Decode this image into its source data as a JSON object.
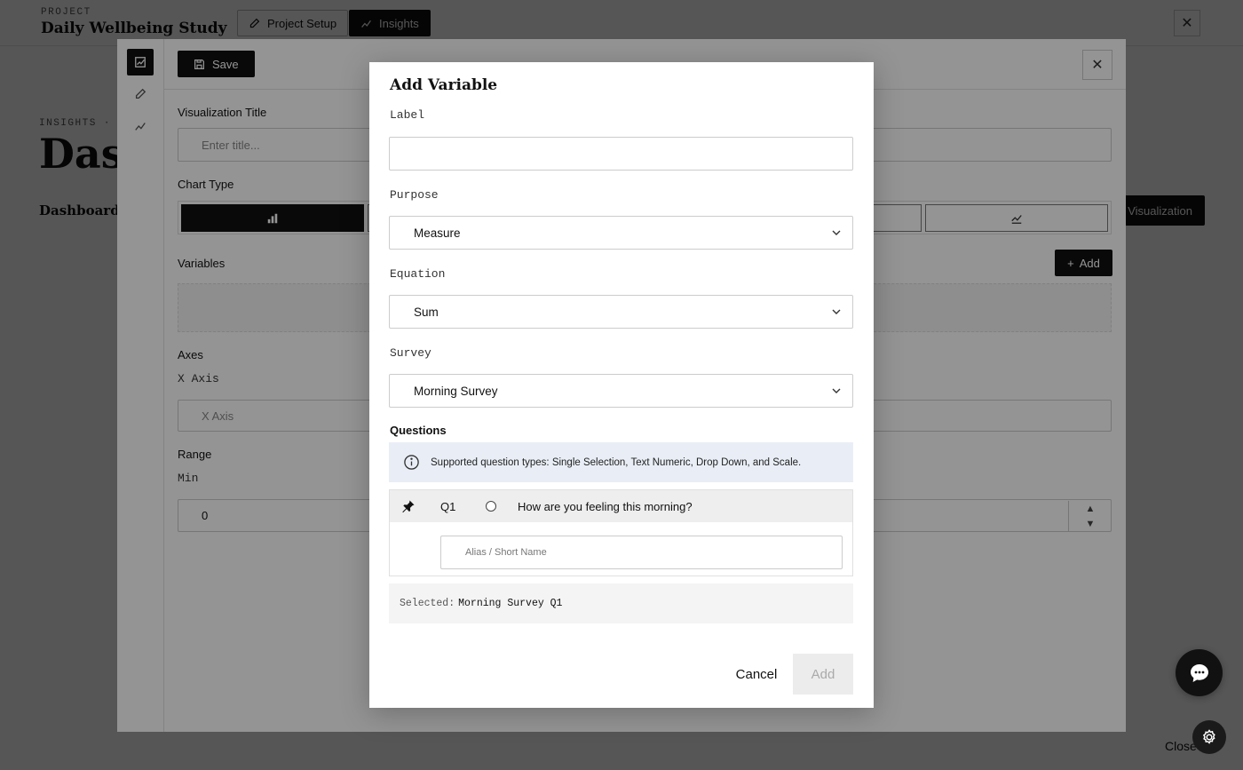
{
  "page": {
    "project_eyebrow": "PROJECT",
    "project_name": "Daily Wellbeing Study",
    "tabs": [
      {
        "label": "Project Setup",
        "icon": "pencil-icon"
      },
      {
        "label": "Insights",
        "icon": "line-chart-icon",
        "active": true
      }
    ],
    "breadcrumb": "INSIGHTS · DA",
    "heading": "Dash",
    "dashboards_label": "Dashboards",
    "new_viz_label": "v Visualization",
    "close_label": "Close"
  },
  "editor": {
    "save_label": "Save",
    "title_label": "Visualization Title",
    "title_placeholder": "Enter title...",
    "chart_type_label": "Chart Type",
    "variables_label": "Variables",
    "add_label": "Add",
    "axes_label": "Axes",
    "x_axis_label": "X Axis",
    "x_axis_placeholder": "X Axis",
    "range_label": "Range",
    "min_label": "Min",
    "min_value": "0"
  },
  "modal": {
    "title": "Add Variable",
    "label_field": {
      "label": "Label",
      "value": ""
    },
    "purpose": {
      "label": "Purpose",
      "value": "Measure"
    },
    "equation": {
      "label": "Equation",
      "value": "Sum"
    },
    "survey": {
      "label": "Survey",
      "value": "Morning Survey"
    },
    "questions_heading": "Questions",
    "info_text": "Supported question types: Single Selection, Text Numeric, Drop Down, and Scale.",
    "question": {
      "id": "Q1",
      "text": "How are you feeling this morning?"
    },
    "alias_placeholder": "Alias / Short Name",
    "selected_prefix": "Selected:",
    "selected_value": "Morning Survey Q1",
    "cancel_label": "Cancel",
    "add_label": "Add"
  },
  "colors": {
    "primary": "#111111",
    "info_bg": "#e9eef6",
    "overlay": "rgba(0,0,0,0.42)"
  }
}
